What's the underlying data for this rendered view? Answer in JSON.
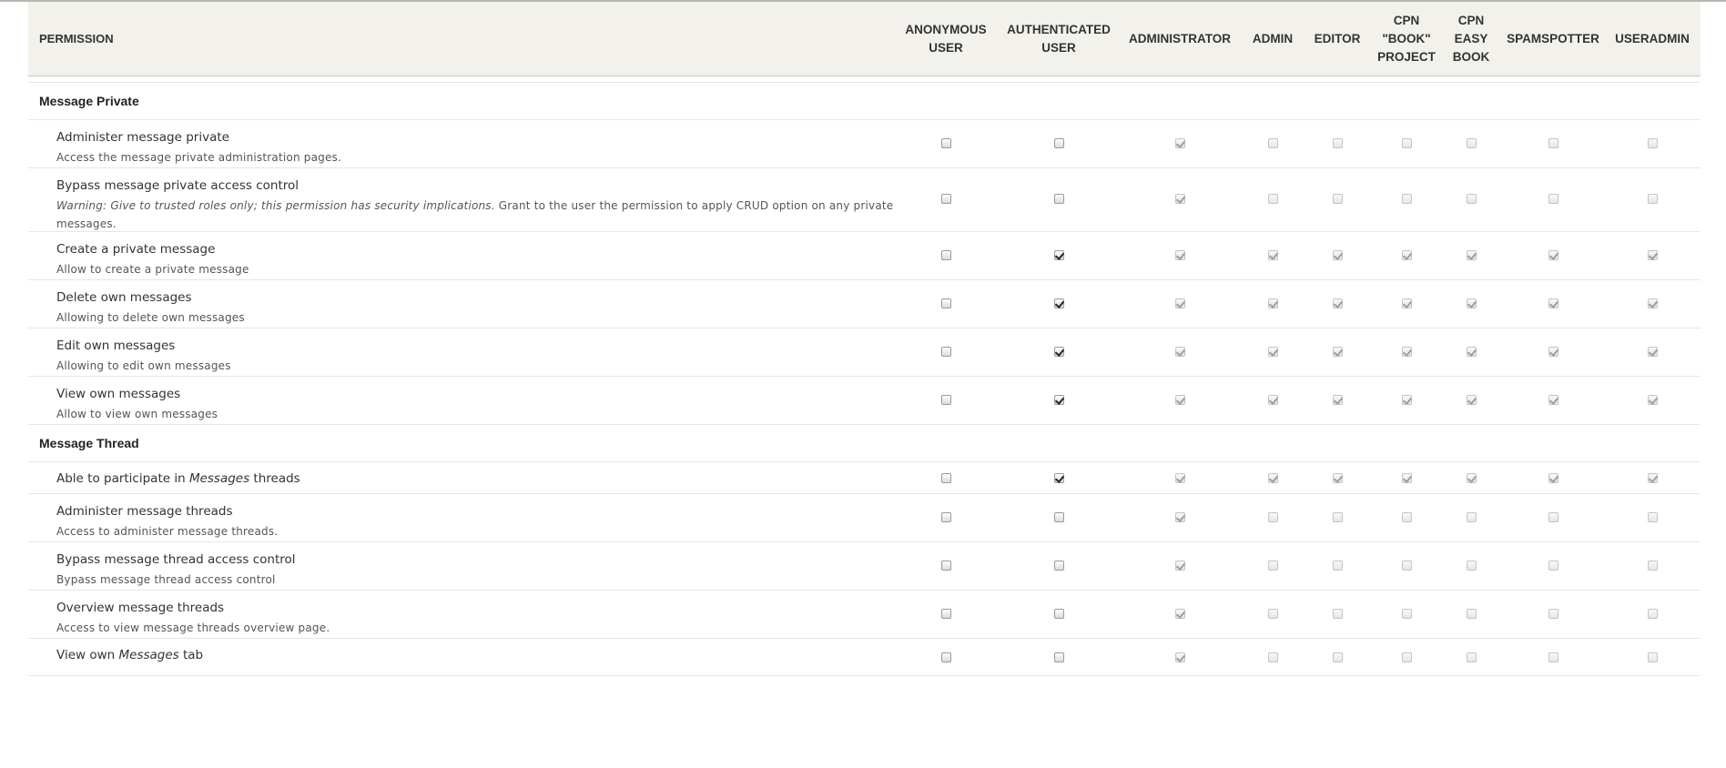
{
  "columns": [
    {
      "id": "anonymous",
      "label": "ANONYMOUS\nUSER"
    },
    {
      "id": "authenticated",
      "label": "AUTHENTICATED\nUSER"
    },
    {
      "id": "administrator",
      "label": "ADMINISTRATOR"
    },
    {
      "id": "admin",
      "label": "ADMIN"
    },
    {
      "id": "editor",
      "label": "EDITOR"
    },
    {
      "id": "cpn-book-project",
      "label": "CPN\n\"BOOK\"\nPROJECT"
    },
    {
      "id": "cpn-easy-book",
      "label": "CPN\nEASY\nBOOK"
    },
    {
      "id": "spamspotter",
      "label": "SPAMSPOTTER"
    },
    {
      "id": "useradmin",
      "label": "USERADMIN"
    }
  ],
  "permission_header": "PERMISSION",
  "sections": [
    {
      "title": "Message Private",
      "rows": [
        {
          "title_parts": [
            {
              "t": "Administer message private"
            }
          ],
          "desc_parts": [
            {
              "t": "Access the message private administration pages."
            }
          ],
          "checked": [
            false,
            false,
            true,
            false,
            false,
            false,
            false,
            false,
            false
          ]
        },
        {
          "title_parts": [
            {
              "t": "Bypass message private access control"
            }
          ],
          "desc_parts": [
            {
              "t": "Warning: Give to trusted roles only; this permission has security implications.",
              "em": true
            },
            {
              "t": " Grant to the user the permission to apply CRUD option on any private messages."
            }
          ],
          "checked": [
            false,
            false,
            true,
            false,
            false,
            false,
            false,
            false,
            false
          ]
        },
        {
          "title_parts": [
            {
              "t": "Create a private message"
            }
          ],
          "desc_parts": [
            {
              "t": "Allow to create a private message"
            }
          ],
          "checked": [
            false,
            true,
            true,
            true,
            true,
            true,
            true,
            true,
            true
          ]
        },
        {
          "title_parts": [
            {
              "t": "Delete own messages"
            }
          ],
          "desc_parts": [
            {
              "t": "Allowing to delete own messages"
            }
          ],
          "checked": [
            false,
            true,
            true,
            true,
            true,
            true,
            true,
            true,
            true
          ]
        },
        {
          "title_parts": [
            {
              "t": "Edit own messages"
            }
          ],
          "desc_parts": [
            {
              "t": "Allowing to edit own messages"
            }
          ],
          "checked": [
            false,
            true,
            true,
            true,
            true,
            true,
            true,
            true,
            true
          ]
        },
        {
          "title_parts": [
            {
              "t": "View own messages"
            }
          ],
          "desc_parts": [
            {
              "t": "Allow to view own messages"
            }
          ],
          "checked": [
            false,
            true,
            true,
            true,
            true,
            true,
            true,
            true,
            true
          ]
        }
      ]
    },
    {
      "title": "Message Thread",
      "rows": [
        {
          "title_parts": [
            {
              "t": "Able to participate in "
            },
            {
              "t": "Messages",
              "em": true
            },
            {
              "t": " threads"
            }
          ],
          "desc_parts": [],
          "checked": [
            false,
            true,
            true,
            true,
            true,
            true,
            true,
            true,
            true
          ]
        },
        {
          "title_parts": [
            {
              "t": "Administer message threads"
            }
          ],
          "desc_parts": [
            {
              "t": "Access to administer message threads."
            }
          ],
          "checked": [
            false,
            false,
            true,
            false,
            false,
            false,
            false,
            false,
            false
          ]
        },
        {
          "title_parts": [
            {
              "t": "Bypass message thread access control"
            }
          ],
          "desc_parts": [
            {
              "t": "Bypass message thread access control"
            }
          ],
          "checked": [
            false,
            false,
            true,
            false,
            false,
            false,
            false,
            false,
            false
          ]
        },
        {
          "title_parts": [
            {
              "t": "Overview message threads"
            }
          ],
          "desc_parts": [
            {
              "t": "Access to view message threads overview page."
            }
          ],
          "checked": [
            false,
            false,
            true,
            false,
            false,
            false,
            false,
            false,
            false
          ]
        },
        {
          "title_parts": [
            {
              "t": "View own "
            },
            {
              "t": "Messages",
              "em": true
            },
            {
              "t": " tab"
            }
          ],
          "desc_parts": [],
          "checked": [
            false,
            false,
            true,
            false,
            false,
            false,
            false,
            false,
            false
          ]
        }
      ]
    }
  ],
  "colors": {
    "header_bg": "#f2f1ec",
    "row_border": "#e6e6e2"
  }
}
